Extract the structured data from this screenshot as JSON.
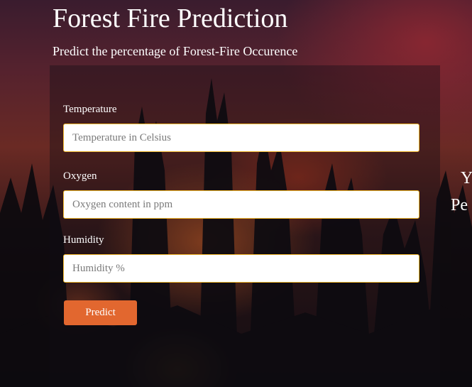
{
  "header": {
    "title": "Forest Fire Prediction",
    "subtitle": "Predict the percentage of Forest-Fire Occurence"
  },
  "form": {
    "temperature": {
      "label": "Temperature",
      "placeholder": "Temperature in Celsius",
      "value": ""
    },
    "oxygen": {
      "label": "Oxygen",
      "placeholder": "Oxygen content in ppm",
      "value": ""
    },
    "humidity": {
      "label": "Humidity",
      "placeholder": "Humidity %",
      "value": ""
    },
    "predict_label": "Predict"
  },
  "result": {
    "line1": "Y",
    "line2": "Pe"
  },
  "colors": {
    "button": "#e2672f",
    "input_border": "#f0b62a",
    "text": "#ffffff"
  }
}
